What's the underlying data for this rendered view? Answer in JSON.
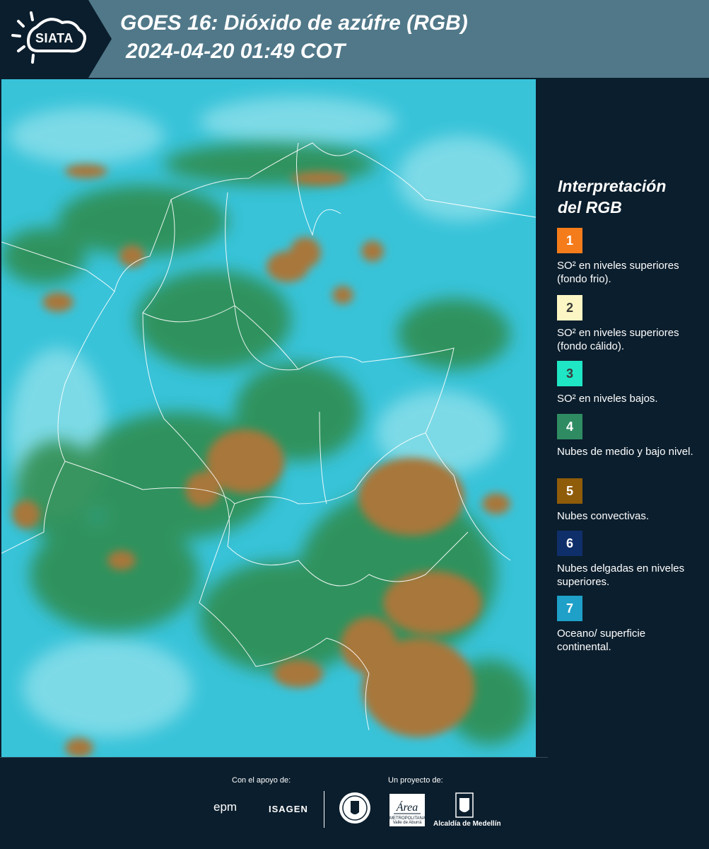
{
  "header": {
    "logo_text": "SIATA",
    "title": "GOES 16: Dióxido de azúfre (RGB)",
    "subtitle": "2024-04-20 01:49 COT"
  },
  "legend": {
    "title_line1": "Interpretación",
    "title_line2": "del RGB",
    "items": [
      {
        "number": "1",
        "label": "SO² en niveles superiores (fondo frio).",
        "color": "#f57c1b"
      },
      {
        "number": "2",
        "label": "SO² en niveles superiores (fondo cálido).",
        "color": "#fbf6c4"
      },
      {
        "number": "3",
        "label": "SO² en niveles bajos.",
        "color": "#1fe6c5"
      },
      {
        "number": "4",
        "label": "Nubes de medio y bajo nivel.",
        "color": "#2f8c62"
      },
      {
        "number": "5",
        "label": "Nubes convectivas.",
        "color": "#8f5c0a"
      },
      {
        "number": "6",
        "label": "Nubes delgadas en niveles superiores.",
        "color": "#0f2f6a"
      },
      {
        "number": "7",
        "label": "Oceano/ superficie continental.",
        "color": "#1ea0c8"
      }
    ]
  },
  "footer": {
    "support_label": "Con el apoyo de:",
    "project_label": "Un proyecto de:",
    "sponsor1": "epm",
    "sponsor2": "ISAGEN",
    "partner_area": "Área",
    "partner_area_sub": "METROPOLITANA Valle de Aburrá",
    "partner_alcaldia": "Alcaldía de Medellín"
  },
  "colors": {
    "header_bg": "#507889",
    "panel_bg": "#0b1e2d",
    "ocean": "#39c4dc",
    "cloud_green": "#3f8f4c",
    "convective": "#a8773a"
  }
}
